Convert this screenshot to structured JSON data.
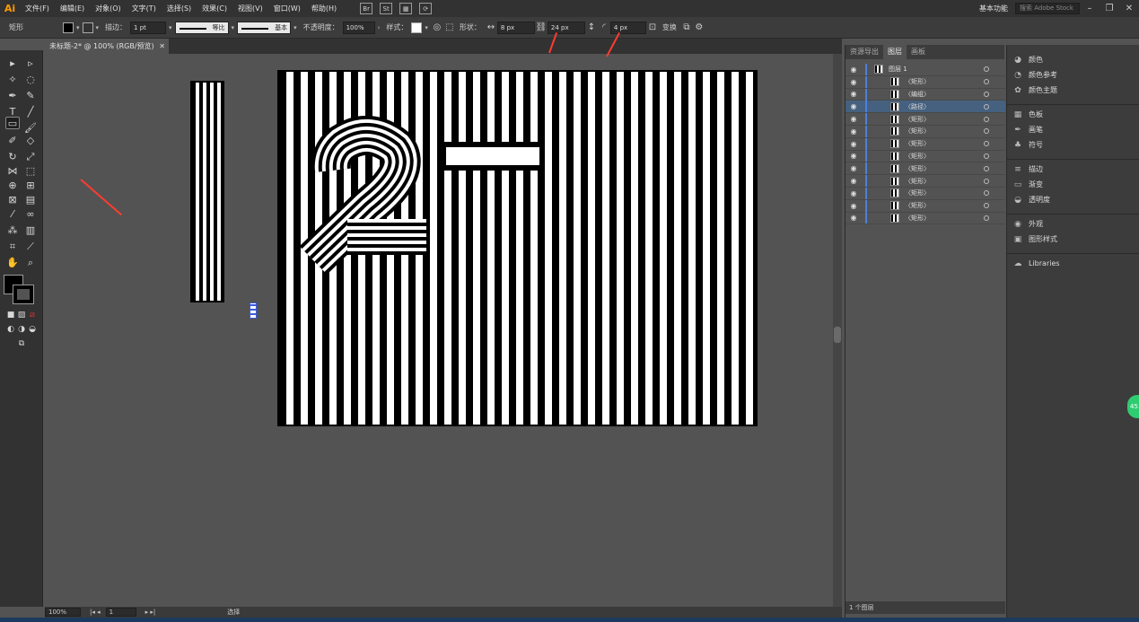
{
  "app": {
    "logo": "Ai"
  },
  "menu": [
    "文件(F)",
    "编辑(E)",
    "对象(O)",
    "文字(T)",
    "选择(S)",
    "效果(C)",
    "视图(V)",
    "窗口(W)",
    "帮助(H)"
  ],
  "menu_right": {
    "workspace": "基本功能",
    "stock_search": "搜索 Adobe Stock"
  },
  "control": {
    "tool_name": "矩形",
    "stroke_label": "描边：",
    "stroke_value": "1 pt",
    "profile_label": "等比",
    "brush_label": "基本",
    "opacity_label": "不透明度：",
    "opacity_value": "100%",
    "style_label": "样式：",
    "shape_label": "形状：",
    "width_value": "8 px",
    "height_value": "24 px",
    "corner_value": "4 px",
    "transform_label": "变换"
  },
  "document": {
    "tab_title": "未标题-2* @ 100% (RGB/预览)"
  },
  "status": {
    "zoom": "100%",
    "page": "1",
    "tool": "选择"
  },
  "layers": {
    "tabs": [
      "资源导出",
      "图层",
      "画板"
    ],
    "active_tab": "图层",
    "rows": [
      "图层 1",
      "〈矩形〉",
      "〈编组〉",
      "〈路径〉",
      "〈矩形〉",
      "〈矩形〉",
      "〈矩形〉",
      "〈矩形〉",
      "〈矩形〉",
      "〈矩形〉",
      "〈矩形〉",
      "〈矩形〉",
      "〈矩形〉"
    ],
    "selected_index": 3,
    "footer": "1 个图层"
  },
  "right_panels": [
    {
      "icon": "color-icon",
      "label": "颜色"
    },
    {
      "icon": "color-guide-icon",
      "label": "颜色参考"
    },
    {
      "icon": "color-theme-icon",
      "label": "颜色主题"
    },
    {
      "icon": "swatches-icon",
      "label": "色板"
    },
    {
      "icon": "brush-icon",
      "label": "画笔"
    },
    {
      "icon": "symbol-icon",
      "label": "符号"
    },
    {
      "icon": "stroke-icon",
      "label": "描边"
    },
    {
      "icon": "gradient-icon",
      "label": "渐变"
    },
    {
      "icon": "transparency-icon",
      "label": "透明度"
    },
    {
      "icon": "appearance-icon",
      "label": "外观"
    },
    {
      "icon": "graphic-styles-icon",
      "label": "图形样式"
    },
    {
      "icon": "libraries-icon",
      "label": "Libraries"
    }
  ],
  "badge": "45",
  "colors": {
    "accent_arrow": "#ff3b30",
    "selection": "#46617f"
  }
}
